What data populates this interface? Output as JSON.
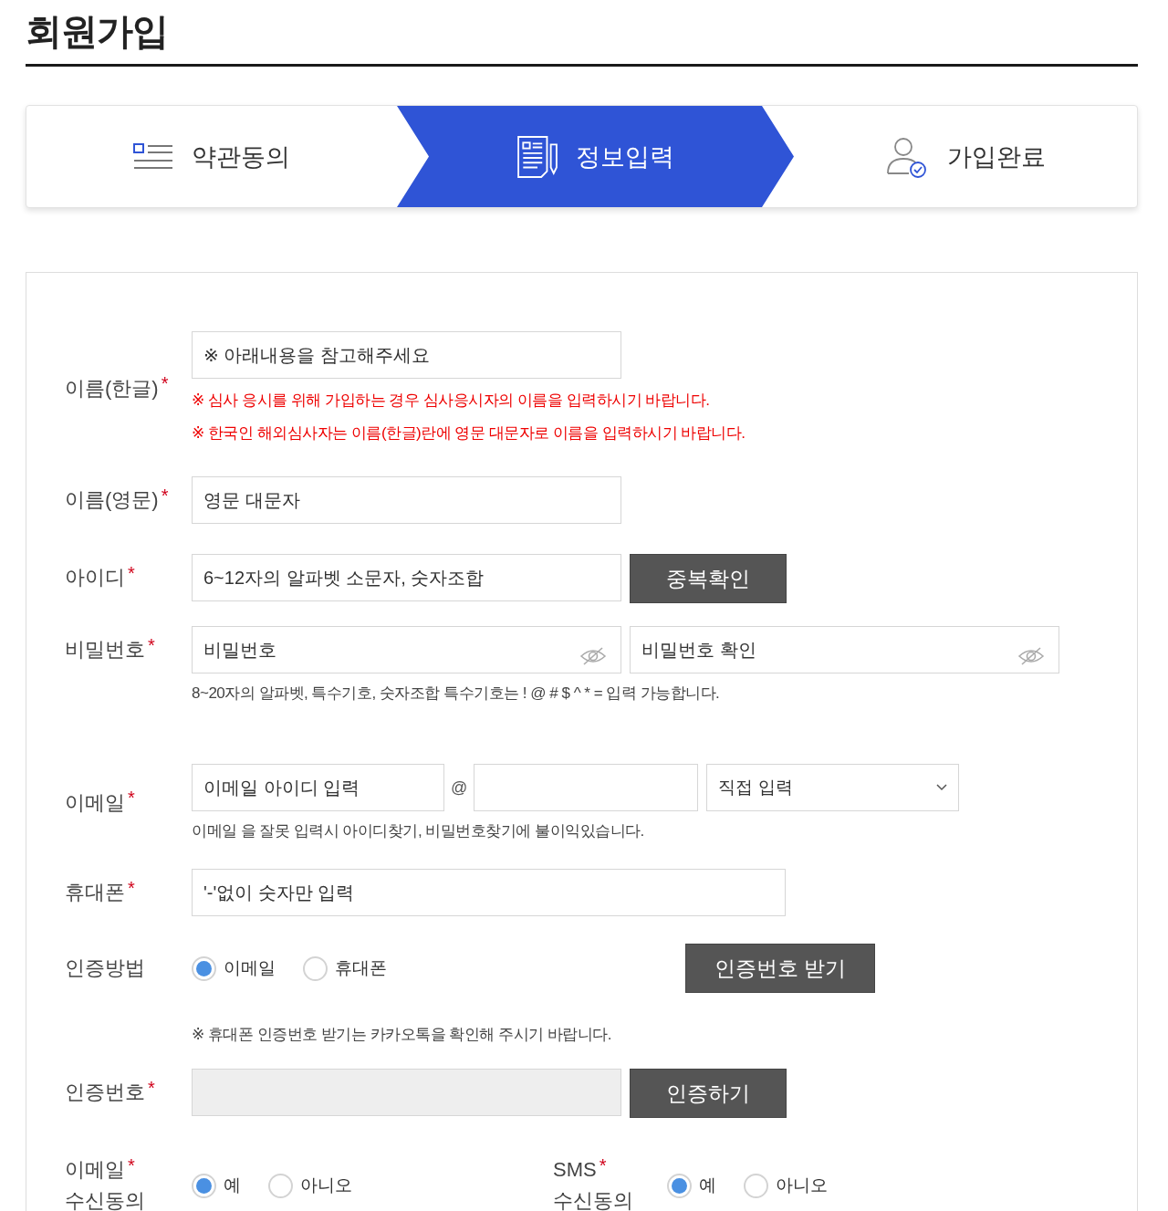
{
  "page_title": "회원가입",
  "required_mark": "*",
  "steps": [
    {
      "kind": "terms",
      "label": "약관동의",
      "selected": false
    },
    {
      "kind": "info",
      "label": "정보입력",
      "selected": true
    },
    {
      "kind": "done",
      "label": "가입완료",
      "selected": false
    }
  ],
  "name_ko": {
    "label": "이름(한글)",
    "required": true,
    "placeholder": "※ 아래내용을 참고해주세요",
    "notes": [
      "※ 심사 응시를 위해 가입하는 경우 심사응시자의 이름을 입력하시기 바랍니다.",
      "※ 한국인 해외심사자는 이름(한글)란에 영문 대문자로 이름을 입력하시기 바랍니다."
    ]
  },
  "name_en": {
    "label": "이름(영문)",
    "required": true,
    "placeholder": "영문 대문자"
  },
  "user_id": {
    "label": "아이디",
    "required": true,
    "placeholder": "6~12자의 알파벳 소문자, 숫자조합",
    "button": "중복확인"
  },
  "password": {
    "label": "비밀번호",
    "required": true,
    "inputs": [
      {
        "placeholder": "비밀번호"
      },
      {
        "placeholder": "비밀번호 확인"
      }
    ],
    "note": "8~20자의 알파벳, 특수기호, 숫자조합 특수기호는 ! @ # $ ^ * = 입력 가능합니다."
  },
  "email": {
    "label": "이메일",
    "required": true,
    "id_placeholder": "이메일 아이디 입력",
    "at": "@",
    "domain_select": "직접 입력",
    "note": "이메일 을 잘못 입력시 아이디찾기, 비밀번호찾기에 불이익있습니다."
  },
  "phone": {
    "label": "휴대폰",
    "required": true,
    "placeholder": "'-'없이 숫자만 입력"
  },
  "auth_method": {
    "label": "인증방법",
    "options": [
      {
        "label": "이메일",
        "selected": true
      },
      {
        "label": "휴대폰",
        "selected": false
      }
    ],
    "button": "인증번호 받기",
    "note": "※ 휴대폰 인증번호 받기는 카카오톡을 확인해 주시기 바랍니다."
  },
  "auth_code": {
    "label": "인증번호",
    "required": true,
    "disabled": true,
    "button": "인증하기"
  },
  "consents": [
    {
      "label": "이메일",
      "label_second_line": "수신동의",
      "required": true,
      "options": [
        {
          "label": "예",
          "selected": true
        },
        {
          "label": "아니오",
          "selected": false
        }
      ]
    },
    {
      "label": "SMS",
      "label_second_line": "수신동의",
      "required": true,
      "options": [
        {
          "label": "예",
          "selected": true
        },
        {
          "label": "아니오",
          "selected": false
        }
      ]
    }
  ]
}
